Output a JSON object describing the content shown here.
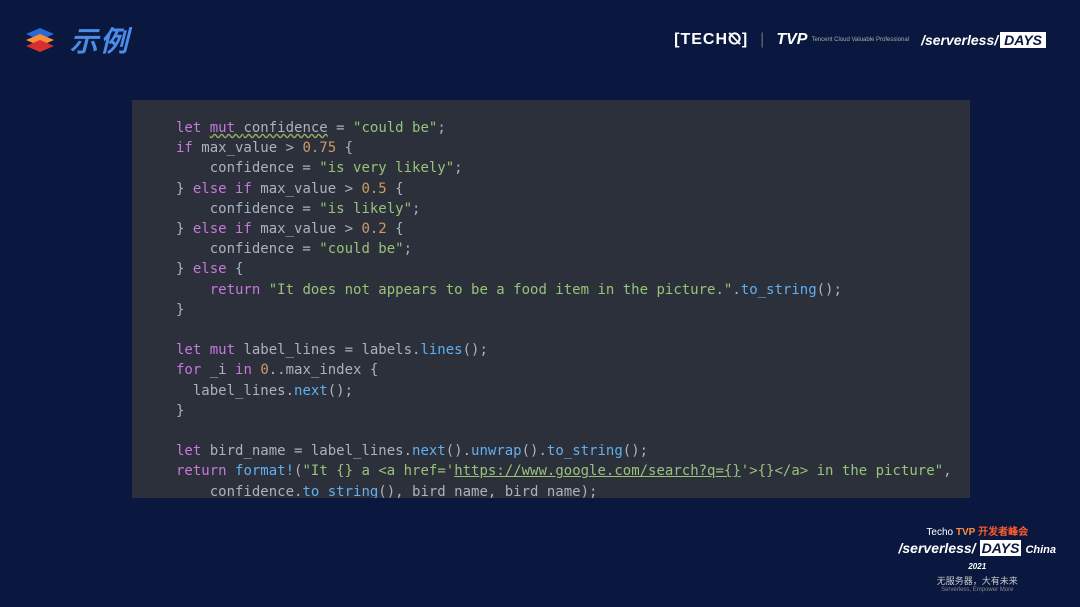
{
  "title": "示例",
  "brands": {
    "techo": "TECH⦰",
    "tvp": "TVP",
    "tvp_sub": "Tencent Cloud\nValuable Professional",
    "serverless": "/serverless/",
    "days": "DAYS"
  },
  "code": {
    "lines": [
      [
        [
          "key",
          "let "
        ],
        [
          "mut",
          "mut "
        ],
        [
          "var",
          "confidence"
        ],
        [
          "ident",
          " = "
        ],
        [
          "str",
          "\"could be\""
        ],
        [
          "punc",
          ";"
        ]
      ],
      [
        [
          "key",
          "if"
        ],
        [
          "ident",
          " max_value > "
        ],
        [
          "num",
          "0.75"
        ],
        [
          "ident",
          " {"
        ]
      ],
      [
        [
          "ident",
          "    confidence = "
        ],
        [
          "str",
          "\"is very likely\""
        ],
        [
          "punc",
          ";"
        ]
      ],
      [
        [
          "ident",
          "} "
        ],
        [
          "key",
          "else if"
        ],
        [
          "ident",
          " max_value > "
        ],
        [
          "num",
          "0.5"
        ],
        [
          "ident",
          " {"
        ]
      ],
      [
        [
          "ident",
          "    confidence = "
        ],
        [
          "str",
          "\"is likely\""
        ],
        [
          "punc",
          ";"
        ]
      ],
      [
        [
          "ident",
          "} "
        ],
        [
          "key",
          "else if"
        ],
        [
          "ident",
          " max_value > "
        ],
        [
          "num",
          "0.2"
        ],
        [
          "ident",
          " {"
        ]
      ],
      [
        [
          "ident",
          "    confidence = "
        ],
        [
          "str",
          "\"could be\""
        ],
        [
          "punc",
          ";"
        ]
      ],
      [
        [
          "ident",
          "} "
        ],
        [
          "key",
          "else"
        ],
        [
          "ident",
          " {"
        ]
      ],
      [
        [
          "ident",
          "    "
        ],
        [
          "key",
          "return"
        ],
        [
          "ident",
          " "
        ],
        [
          "str",
          "\"It does not appears to be a food item in the picture.\""
        ],
        [
          "ident",
          "."
        ],
        [
          "call",
          "to_string"
        ],
        [
          "ident",
          "();"
        ]
      ],
      [
        [
          "ident",
          "}"
        ]
      ],
      [
        [
          "ident",
          ""
        ]
      ],
      [
        [
          "key",
          "let "
        ],
        [
          "key",
          "mut"
        ],
        [
          "ident",
          " label_lines = labels."
        ],
        [
          "call",
          "lines"
        ],
        [
          "ident",
          "();"
        ]
      ],
      [
        [
          "key",
          "for"
        ],
        [
          "ident",
          " _i "
        ],
        [
          "key",
          "in"
        ],
        [
          "ident",
          " "
        ],
        [
          "num",
          "0"
        ],
        [
          "ident",
          "..max_index {"
        ]
      ],
      [
        [
          "ident",
          "  label_lines."
        ],
        [
          "call",
          "next"
        ],
        [
          "ident",
          "();"
        ]
      ],
      [
        [
          "ident",
          "}"
        ]
      ],
      [
        [
          "ident",
          ""
        ]
      ],
      [
        [
          "key",
          "let"
        ],
        [
          "ident",
          " bird_name = label_lines."
        ],
        [
          "call",
          "next"
        ],
        [
          "ident",
          "()."
        ],
        [
          "call",
          "unwrap"
        ],
        [
          "ident",
          "()."
        ],
        [
          "call",
          "to_string"
        ],
        [
          "ident",
          "();"
        ]
      ],
      [
        [
          "key",
          "return"
        ],
        [
          "ident",
          " "
        ],
        [
          "call",
          "format!"
        ],
        [
          "ident",
          "("
        ],
        [
          "str",
          "\"It {} a <a href='"
        ],
        [
          "url",
          "https://www.google.com/search?q={}"
        ],
        [
          "str",
          "'>{}</a> in the picture\""
        ],
        [
          "ident",
          ","
        ]
      ],
      [
        [
          "ident",
          "    confidence."
        ],
        [
          "call",
          "to_string"
        ],
        [
          "ident",
          "(), bird_name, bird_name);"
        ]
      ]
    ]
  },
  "footer": {
    "line1_a": "Techo",
    "line1_b": "TVP",
    "line1_c": "开发者峰会",
    "line2_a": "/serverless/",
    "line2_b": "DAYS",
    "line2_c": "China",
    "line2_d": "2021",
    "line3": "无服务器，大有未来",
    "line4": "Serverless, Empower More"
  }
}
